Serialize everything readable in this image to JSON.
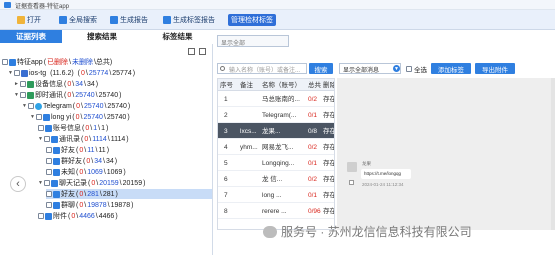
{
  "window": {
    "title": "证据查看器-特征app"
  },
  "toolbar": {
    "open": "打开",
    "global_search": "全局搜索",
    "generate_report": "生成报告",
    "generate_tag_report": "生成标签报告",
    "manage_tags": "管理检材标签"
  },
  "tabs": {
    "evidence_list": "证据列表",
    "search_results": "搜索结果",
    "tag_results": "标签结果"
  },
  "tree": {
    "root": {
      "name": "特征app",
      "open": "(",
      "deleted": "已删除",
      "sep": "\\",
      "undeleted": "未删除",
      "close": "\\总共)"
    },
    "ios": {
      "name": "ios-tg",
      "version": "(11.6.2)",
      "open": "(",
      "a": "0",
      "b": "25774",
      "c": "25774",
      "close": ")"
    },
    "device": {
      "name": "设备信息",
      "open": "(",
      "a": "0",
      "b": "34",
      "c": "34",
      "close": ")"
    },
    "im": {
      "name": "即时通讯",
      "open": "(",
      "a": "0",
      "b": "25740",
      "c": "25740",
      "close": ")"
    },
    "telegram": {
      "name": "Telegram",
      "open": "(",
      "a": "0",
      "b": "25740",
      "c": "25740",
      "close": ")"
    },
    "user": {
      "name": "long yi",
      "open": "(",
      "a": "0",
      "b": "25740",
      "c": "25740",
      "close": ")"
    },
    "account": {
      "name": "账号信息",
      "open": "(",
      "a": "0",
      "b": "1",
      "c": "1",
      "close": ")"
    },
    "contacts": {
      "name": "通讯录",
      "open": "(",
      "a": "0",
      "b": "1114",
      "c": "1114",
      "close": ")"
    },
    "friends": {
      "name": "好友",
      "open": "(",
      "a": "0",
      "b": "11",
      "c": "11",
      "close": ")"
    },
    "group_members": {
      "name": "群好友",
      "open": "(",
      "a": "0",
      "b": "34",
      "c": "34",
      "close": ")"
    },
    "unknown": {
      "name": "未知",
      "open": "(",
      "a": "0",
      "b": "1069",
      "c": "1069",
      "close": ")"
    },
    "chats": {
      "name": "聊天记录",
      "open": "(",
      "a": "0",
      "b": "20159",
      "c": "20159",
      "close": ")"
    },
    "chat_friends": {
      "name": "好友",
      "open": "(",
      "a": "0",
      "b": "281",
      "c": "281",
      "close": ")"
    },
    "chat_groups": {
      "name": "群聊",
      "open": "(",
      "a": "0",
      "b": "19878",
      "c": "19878",
      "close": ")"
    },
    "attachments": {
      "name": "附件",
      "open": "(",
      "a": "0",
      "b": "4466",
      "c": "4466",
      "close": ")"
    },
    "sep": "\\"
  },
  "right": {
    "filter_placeholder": "显示全部",
    "search_placeholder": "输入名称（账号）或备注...",
    "search_button": "搜索",
    "message_filter": "显示全部消息",
    "select_all": "全选",
    "add_tag": "添加标签",
    "export_attachments": "导出附件"
  },
  "table": {
    "headers": [
      "序号",
      "备注",
      "名称（账号）",
      "总共",
      "删除"
    ],
    "rows": [
      {
        "index": "1",
        "note": "",
        "name": "马总账南的...",
        "total": "0/2",
        "status": "存在"
      },
      {
        "index": "2",
        "note": "",
        "name": "Telegram(...",
        "total": "0/1",
        "status": "存在"
      },
      {
        "index": "3",
        "note": "lxcs...",
        "name": "龙果...",
        "total": "0/8",
        "status": "存在"
      },
      {
        "index": "4",
        "note": "yhm...",
        "name": "网易龙飞...",
        "total": "0/2",
        "status": "存在"
      },
      {
        "index": "5",
        "note": "",
        "name": "Longqing...",
        "total": "0/1",
        "status": "存在"
      },
      {
        "index": "6",
        "note": "",
        "name": "龙 信...",
        "total": "0/2",
        "status": "存在"
      },
      {
        "index": "7",
        "note": "",
        "name": "long ...",
        "total": "0/1",
        "status": "存在"
      },
      {
        "index": "8",
        "note": "",
        "name": "rerere ...",
        "total": "0/96",
        "status": "存在"
      }
    ]
  },
  "chat": {
    "sender": "龙果",
    "message": "https://t.me/longqg",
    "timestamp": "2024-01-24 11:12:34"
  },
  "watermark": {
    "text": "服务号 · 苏州龙信信息科技有限公司"
  }
}
